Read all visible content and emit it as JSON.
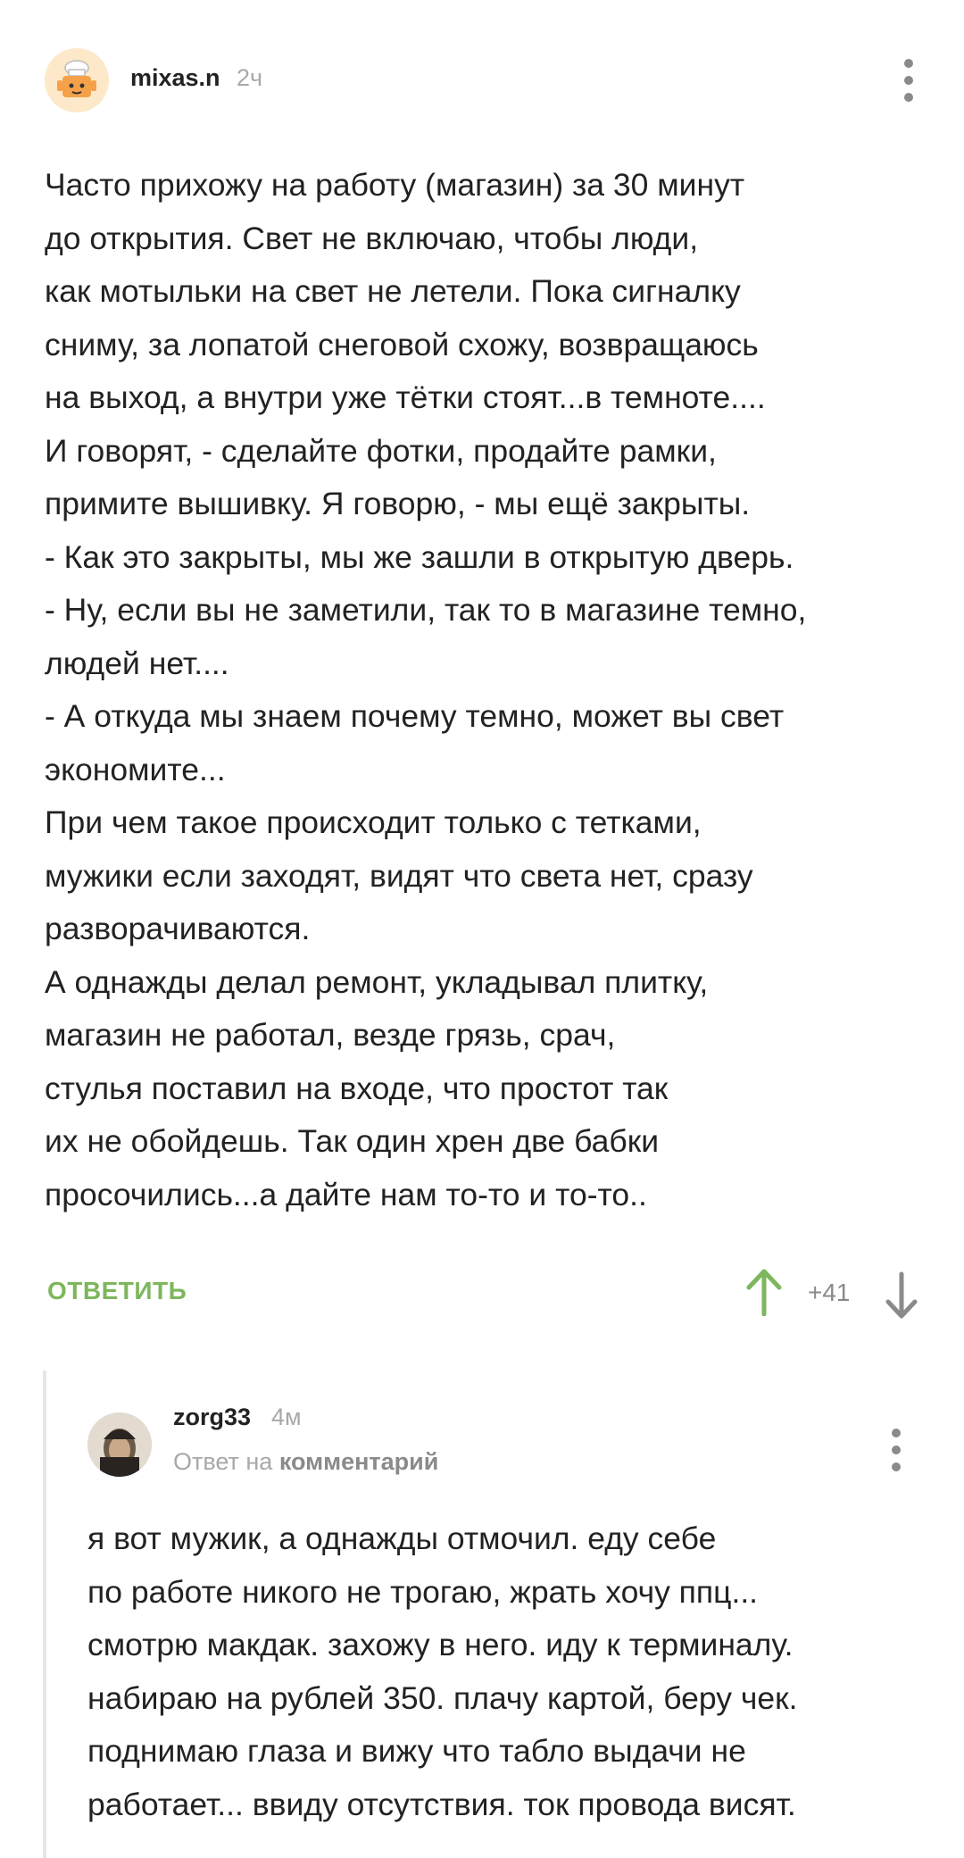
{
  "comment": {
    "author": "mixas.n",
    "time": "2ч",
    "lines": [
      "Часто прихожу на работу (магазин) за 30 минут",
      "до открытия. Свет не включаю, чтобы люди,",
      "как мотыльки на свет не летели. Пока сигналку",
      "сниму, за лопатой снеговой схожу, возвращаюсь",
      "на выход, а внутри уже тётки стоят...в темноте....",
      "И говорят, - сделайте фотки, продайте рамки,",
      "примите вышивку. Я говорю, - мы ещё закрыты.",
      "- Как это закрыты, мы же зашли в открытую дверь.",
      "- Ну, если вы не заметили, так то в магазине темно,",
      "людей нет....",
      "- А откуда мы знаем почему темно, может вы свет",
      "экономите...",
      "При чем такое происходит только с тетками,",
      "мужики если заходят, видят что света нет, сразу",
      "разворачиваются.",
      "А однажды делал ремонт, укладывал плитку,",
      "магазин не работал, везде грязь, срач,",
      "стулья поставил на входе, что простот так",
      "их не обойдешь. Так один хрен две бабки",
      "просочились...а дайте нам то-то и то-то.."
    ],
    "reply_label": "ОТВЕТИТЬ",
    "rating": "+41",
    "upvote_icon": "arrow-up-icon",
    "downvote_icon": "arrow-down-icon",
    "accent_color": "#7db65c"
  },
  "reply": {
    "author": "zorg33",
    "time": "4м",
    "reply_to_prefix": "Ответ на",
    "reply_to_link": "комментарий",
    "lines": [
      "я вот мужик, а однажды отмочил. еду себе",
      "по работе никого не трогаю, жрать хочу ппц...",
      "смотрю макдак. захожу в него. иду к терминалу.",
      "набираю на рублей 350. плачу картой, беру чек.",
      "поднимаю глаза и вижу что табло выдачи не",
      "работает... ввиду отсутствия. ток провода висят."
    ]
  }
}
